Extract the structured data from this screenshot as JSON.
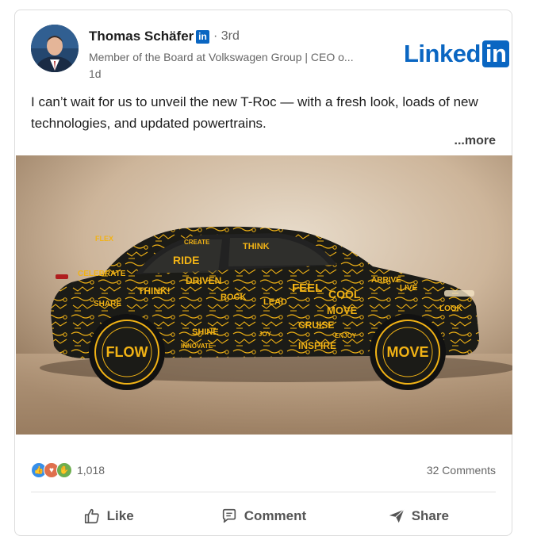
{
  "post": {
    "author_name": "Thomas Schäfer",
    "badge_text": "in",
    "degree": "· 3rd",
    "headline": "Member of the Board at Volkswagen Group | CEO o...",
    "timestamp": "1d",
    "logo_word": "Linked",
    "logo_in": "in",
    "text": "I can’t wait for us to unveil the new T-Roc — with a fresh look, loads of new technologies, and updated powertrains.",
    "see_more": "...more"
  },
  "image": {
    "wheel_front_text": "FLOW",
    "wheel_rear_text": "MOVE",
    "car_words": [
      "FLEX",
      "RIDE",
      "THINK",
      "CELEBRATE",
      "DRIVEN",
      "THINK!",
      "ROCK",
      "LEAD",
      "FEEL",
      "COOL",
      "MOVE",
      "CRUISE",
      "INSPIRE",
      "SHARE",
      "SHINE",
      "INNOVATE",
      "LOOK",
      "LIVE",
      "ARRIVE",
      "CREATE",
      "JOY",
      "ENJOY"
    ]
  },
  "social": {
    "reaction_count": "1,018",
    "comments": "32 Comments"
  },
  "actions": {
    "like": "Like",
    "comment": "Comment",
    "share": "Share"
  },
  "colors": {
    "brand": "#0a66c2",
    "car_body": "#1b1b17",
    "car_pattern": "#f2b315"
  }
}
